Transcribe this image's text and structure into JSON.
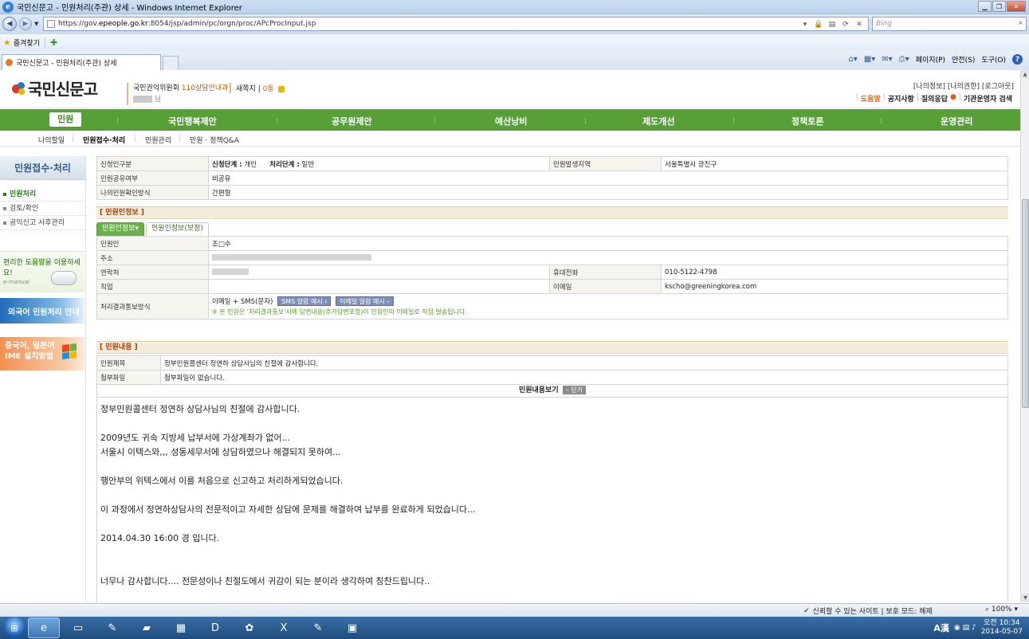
{
  "browser": {
    "title": "국민신문고 - 민원처리(주관) 상세 - Windows Internet Explorer",
    "url_prefix": "https://gov.",
    "url_domain": "epeople.go.kr",
    "url_suffix": ":8054/jsp/admin/pc/orgn/proc/APcProcInput.jsp",
    "search_placeholder": "Bing",
    "favorites_label": "즐겨찾기",
    "tab_title": "국민신문고 - 민원처리(주관) 상세",
    "cmd": {
      "page": "페이지(P)",
      "safety": "안전(S)",
      "tools": "도구(O)"
    },
    "status_trust": "신뢰할 수 있는 사이트 | 보호 모드: 해제",
    "zoom": "100%"
  },
  "header": {
    "logo_text": "국민신문고",
    "org_name": "국민권익위원회",
    "org_dept": "110상담안내과",
    "user_suffix": "님",
    "msg_label": "새쪽지 |",
    "msg_count": "0통",
    "top_links": "[나의정보] [나의권한] [로그아웃]",
    "sub_links": [
      "도움말",
      "공지사항",
      "질의응답",
      "기관운영자 검색"
    ]
  },
  "gnb": [
    "민원",
    "국민행복제안",
    "공무원제안",
    "예산낭비",
    "제도개선",
    "정책토론",
    "운영관리"
  ],
  "lnb": [
    "나의할일",
    "민원접수·처리",
    "민원관리",
    "민원 · 정책Q&A"
  ],
  "sidebar": {
    "title": "민원접수·처리",
    "items": [
      "민원처리",
      "검토/확인",
      "공익신고 사후관리"
    ],
    "help_banner": {
      "text_a": "편리한 ",
      "text_b": "도움말",
      "text_c": "을 이용하세요!",
      "sub": "e-manual"
    },
    "foreign_banner": "외국어 민원처리 안내",
    "ime_banner": [
      "중국어, 일본어",
      "IME 설치방법"
    ]
  },
  "top_table": {
    "r1_label": "신청인구분",
    "r1_stage_label": "신청단계 :",
    "r1_stage": "개인",
    "r1_proc_label": "처리단계 :",
    "r1_proc": "일반",
    "r1_region_label": "민원발생지역",
    "r1_region": "서울특별시 광진구",
    "r2_label": "민원공유여부",
    "r2_value": "비공유",
    "r3_label": "나의민원확인방식",
    "r3_value": "간편형"
  },
  "applicant": {
    "section_title": "[ 민원인정보 ]",
    "tabs": [
      "민원인정보",
      "민원인정보(보정)"
    ],
    "name_label": "민원인",
    "name_value": "조□수",
    "addr_label": "주소",
    "contact_label": "연락처",
    "mobile_label": "휴대전화",
    "mobile_value": "010-5122-4798",
    "job_label": "직업",
    "email_label": "이메일",
    "email_value": "kscho@greeningkorea.com",
    "notify_label": "처리결과통보방식",
    "notify_value": "이메일 + SMS(문자)",
    "sms_btn": "SMS 알람 예시",
    "email_btn": "이메일 알람 예시",
    "notice": "※ 본 민원은 '처리결과통보'시에 답변내용(추가답변포함)이 민원인의 이메일로 직접 발송됩니다."
  },
  "content": {
    "section_title": "[ 민원내용 ]",
    "title_label": "민원제목",
    "title_value": "정부민원콜센터 정연하 상담사님의 친절에 감사합니다.",
    "attach_label": "첨부파일",
    "attach_value": "첨부파일이 없습니다.",
    "view_label": "민원내용보기",
    "close_btn": "닫기",
    "body": "정부민원콜센터 정연하 상담사님의 친절에 감사합니다.\n\n2009년도 귀속 지방세 납부서에 가상계좌가 없어...\n서울시 이텍스와,,, 성동세무서에 상담하였으나 해결되지 못하여...\n\n행안부의 위텍스에서 이를 처음으로 신고하고 처리하게되었습니다.\n\n이 과정에서 정연하상담사의 전문적이고 자세한 상담에 문제를 해결하여 납부를 완료하게 되었습니다...\n\n2014.04.30 16:00 경 입니다.\n\n\n너무나 감사합니다.... 전문성이나 친절도에서 귀감이 되는 분이라 생각하여 칭찬드립니다.."
  },
  "taskbar": {
    "ime": "A漢",
    "time": "오전 10:34",
    "date": "2014-05-07"
  },
  "colors": {
    "gnb_green": "#56a037",
    "section_red": "#b13a08",
    "notice_green": "#5d9b2f"
  }
}
